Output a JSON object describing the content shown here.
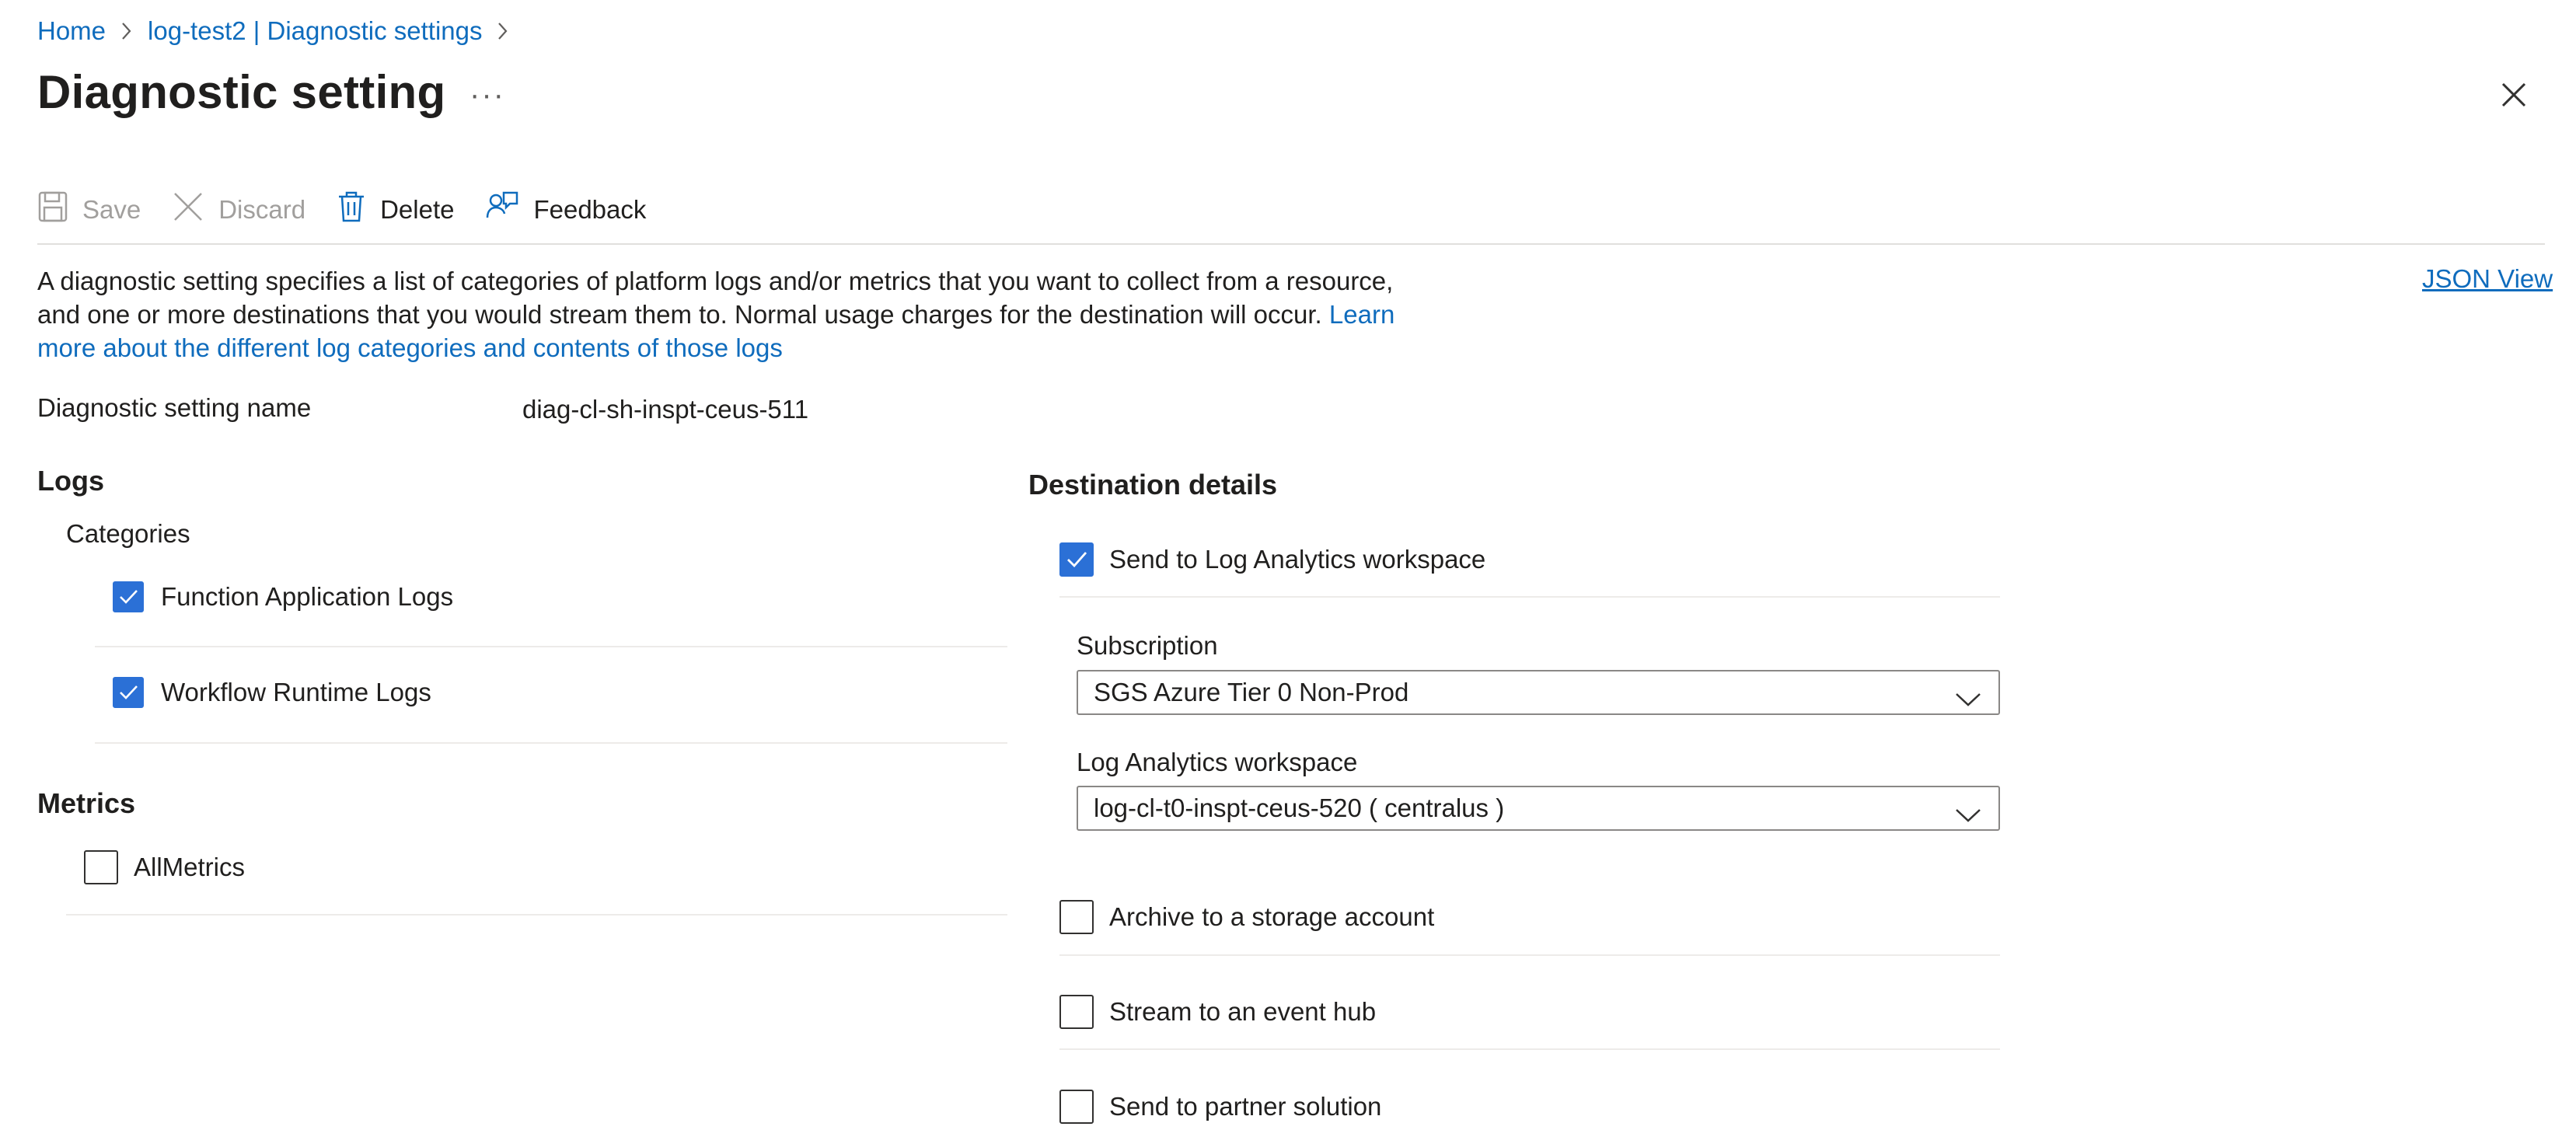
{
  "breadcrumb": {
    "items": [
      "Home",
      "log-test2 | Diagnostic settings"
    ]
  },
  "header": {
    "title": "Diagnostic setting",
    "more": "···"
  },
  "toolbar": {
    "save_label": "Save",
    "discard_label": "Discard",
    "delete_label": "Delete",
    "feedback_label": "Feedback"
  },
  "description": {
    "line1": "A diagnostic setting specifies a list of categories of platform logs and/or metrics that you want to collect from a resource,",
    "line2": "and one or more destinations that you would stream them to. Normal usage charges for the destination will occur.",
    "link_part1": "Learn",
    "link_part2": "more about the different log categories and contents of those logs"
  },
  "json_view_label": "JSON View",
  "setting_name": {
    "label": "Diagnostic setting name",
    "value": "diag-cl-sh-inspt-ceus-511"
  },
  "logs": {
    "heading": "Logs",
    "categories_label": "Categories",
    "items": [
      {
        "label": "Function Application Logs",
        "checked": true
      },
      {
        "label": "Workflow Runtime Logs",
        "checked": true
      }
    ]
  },
  "metrics": {
    "heading": "Metrics",
    "items": [
      {
        "label": "AllMetrics",
        "checked": false
      }
    ]
  },
  "destination": {
    "heading": "Destination details",
    "log_analytics": {
      "label": "Send to Log Analytics workspace",
      "checked": true
    },
    "subscription": {
      "label": "Subscription",
      "value": "SGS Azure Tier 0 Non-Prod"
    },
    "workspace": {
      "label": "Log Analytics workspace",
      "value": "log-cl-t0-inspt-ceus-520 ( centralus )"
    },
    "storage": {
      "label": "Archive to a storage account",
      "checked": false
    },
    "event_hub": {
      "label": "Stream to an event hub",
      "checked": false
    },
    "partner": {
      "label": "Send to partner solution",
      "checked": false
    }
  },
  "colors": {
    "accent": "#2b70d6",
    "link": "#0f6cbd",
    "text": "#201f1e",
    "disabled": "#a19f9d"
  },
  "icons": [
    "chevron-right-icon",
    "more-icon",
    "close-icon",
    "save-icon",
    "discard-icon",
    "delete-icon",
    "feedback-icon",
    "checkmark-icon",
    "chevron-down-icon"
  ]
}
